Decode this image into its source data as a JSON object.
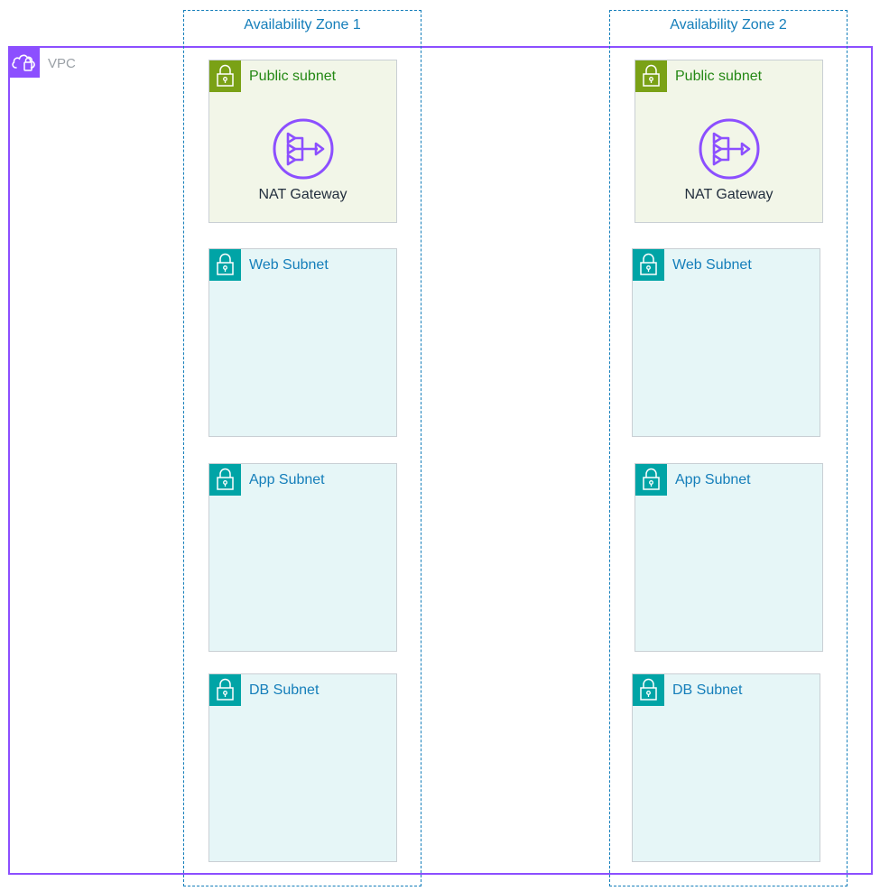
{
  "vpc": {
    "label": "VPC",
    "icon": "vpc-cloud-icon",
    "color": "#8c4fff"
  },
  "zones": [
    {
      "title": "Availability Zone 1",
      "public_subnet": {
        "label": "Public subnet",
        "icon": "lock-icon",
        "nat_label": "NAT Gateway"
      },
      "web_subnet": {
        "label": "Web Subnet",
        "icon": "lock-icon"
      },
      "app_subnet": {
        "label": "App Subnet",
        "icon": "lock-icon"
      },
      "db_subnet": {
        "label": "DB Subnet",
        "icon": "lock-icon"
      }
    },
    {
      "title": "Availability Zone 2",
      "public_subnet": {
        "label": "Public subnet",
        "icon": "lock-icon",
        "nat_label": "NAT Gateway"
      },
      "web_subnet": {
        "label": "Web Subnet",
        "icon": "lock-icon"
      },
      "app_subnet": {
        "label": "App Subnet",
        "icon": "lock-icon"
      },
      "db_subnet": {
        "label": "DB Subnet",
        "icon": "lock-icon"
      }
    }
  ],
  "colors": {
    "vpc_border": "#8c4fff",
    "az_border": "#147eba",
    "public_fill": "#f2f6e8",
    "public_accent": "#7aa116",
    "private_fill": "#e6f6f7",
    "private_accent": "#00a4a6",
    "nat_icon": "#8c4fff"
  }
}
